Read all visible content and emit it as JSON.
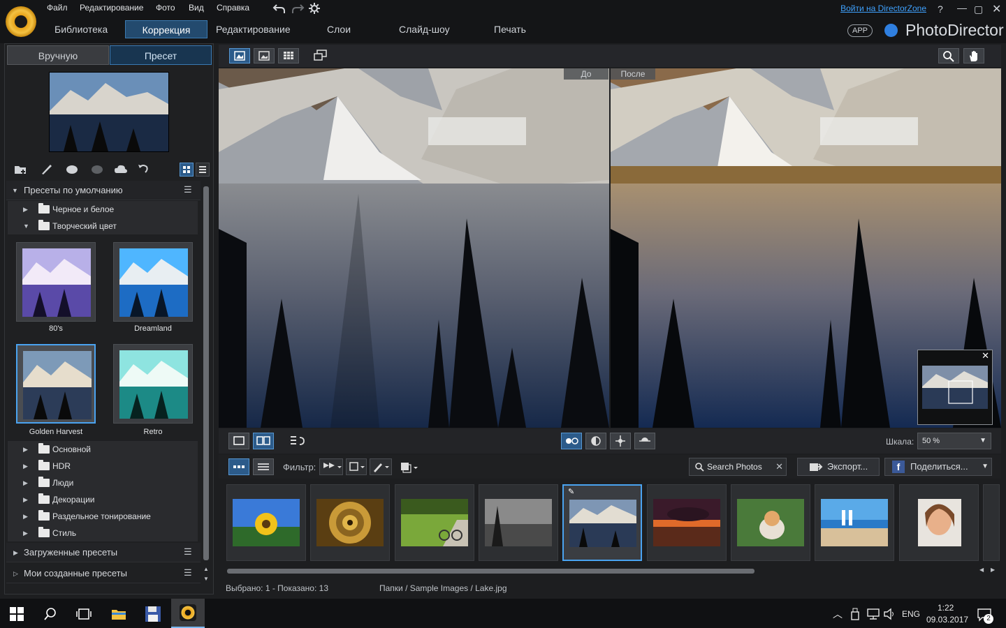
{
  "menu": {
    "file": "Файл",
    "edit": "Редактирование",
    "photo": "Фото",
    "view": "Вид",
    "help": "Справка"
  },
  "modes": [
    "Библиотека",
    "Коррекция",
    "Редактирование",
    "Слои",
    "Слайд-шоу",
    "Печать"
  ],
  "top_right": {
    "login_link": "Войти на DirectorZone",
    "help": "?",
    "app_badge": "APP",
    "product": "PhotoDirector"
  },
  "left_tabs": {
    "manual": "Вручную",
    "preset": "Пресет"
  },
  "presets": {
    "default_section": "Пресеты по умолчанию",
    "folders_top": [
      "Черное и белое",
      "Творческий цвет"
    ],
    "grid": [
      "80's",
      "Dreamland",
      "Golden Harvest",
      "Retro"
    ],
    "folders_bottom": [
      "Основной",
      "HDR",
      "Люди",
      "Декорации",
      "Раздельное тонирование",
      "Стиль"
    ],
    "downloaded": "Загруженные пресеты",
    "mine": "Мои созданные пресеты"
  },
  "compare": {
    "before": "До",
    "after": "После"
  },
  "bottom": {
    "scale_label": "Шкала:",
    "scale_value": "50 %"
  },
  "filter": {
    "label": "Фильтр:",
    "search_placeholder": "Search Photos",
    "export": "Экспорт...",
    "share": "Поделиться..."
  },
  "status": {
    "selection": "Выбрано: 1 - Показано: 13",
    "path": "Папки / Sample Images / Lake.jpg"
  },
  "taskbar": {
    "lang": "ENG",
    "time": "1:22",
    "date": "09.03.2017",
    "notif": "2"
  },
  "colors": {
    "accent": "#2c5b8a",
    "link": "#3fa2ff",
    "selection": "#4aa3f0"
  }
}
